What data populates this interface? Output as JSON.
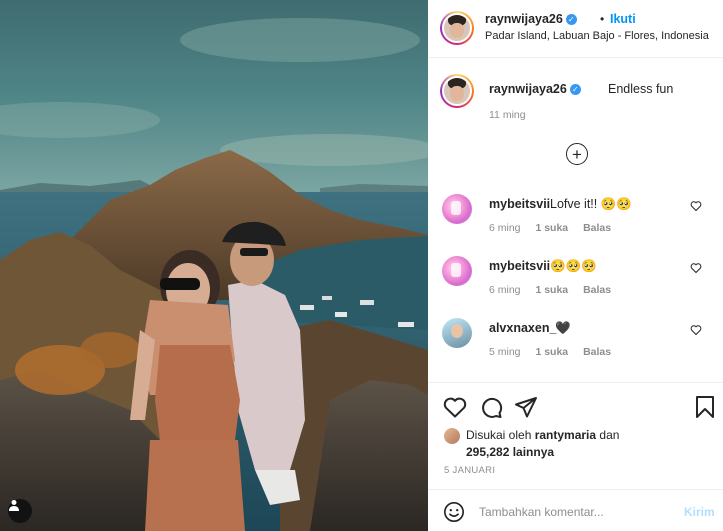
{
  "post": {
    "username": "raynwijaya26",
    "verified_glyph": "✓",
    "dot": "•",
    "follow_label": "Ikuti",
    "location": "Padar Island, Labuan Bajo - Flores, Indonesia",
    "caption": "Endless fun",
    "caption_time": "11 ming"
  },
  "more_comments_glyph": "+",
  "comments": [
    {
      "username": "mybeitsvii",
      "text": "Lofve it!! 🥺🥺",
      "time": "6 ming",
      "likes": "1 suka",
      "reply": "Balas"
    },
    {
      "username": "mybeitsvii",
      "text": "🥺🥺🥺",
      "time": "6 ming",
      "likes": "1 suka",
      "reply": "Balas"
    },
    {
      "username": "alvxnaxen_",
      "text": "🖤",
      "time": "5 ming",
      "likes": "1 suka",
      "reply": "Balas"
    }
  ],
  "likes": {
    "prefix": "Disukai oleh ",
    "user": "rantymaria",
    "suffix": " dan",
    "count_line": "295,282 lainnya"
  },
  "date": "5 JANUARI",
  "add_comment": {
    "placeholder": "Tambahkan komentar...",
    "send_label": "Kirim"
  },
  "icons": {
    "like": "heart-icon",
    "comment": "comment-bubble-icon",
    "share": "paper-plane-icon",
    "save": "bookmark-icon",
    "emoji": "smiley-icon",
    "user_tag": "person-icon"
  },
  "colors": {
    "accent": "#0095f6",
    "verified": "#3897f0",
    "muted": "#8e8e8e",
    "send_disabled": "#b2dffc"
  }
}
